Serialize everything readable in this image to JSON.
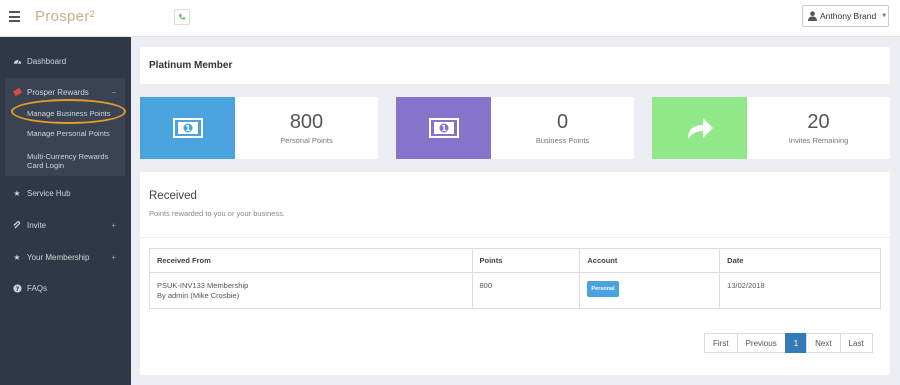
{
  "header": {
    "logo": "Prosper²",
    "user_name": "Anthony Brand"
  },
  "sidebar": {
    "items": [
      {
        "label": "Dashboard",
        "icon": "dashboard-icon"
      },
      {
        "label": "Prosper Rewards",
        "icon": "ticket-icon",
        "toggle": "−"
      },
      {
        "label": "Service Hub",
        "icon": "star-icon"
      },
      {
        "label": "Invite",
        "icon": "paperclip-icon",
        "toggle": "+"
      },
      {
        "label": "Your Membership",
        "icon": "star-icon",
        "toggle": "+"
      },
      {
        "label": "FAQs",
        "icon": "question-icon"
      }
    ],
    "rewards_sub": [
      {
        "label": "Manage Business Points"
      },
      {
        "label": "Manage Personal Points"
      },
      {
        "label": "Multi-Currency Rewards Card Login"
      }
    ]
  },
  "main": {
    "title": "Platinum Member",
    "stats": [
      {
        "value": "800",
        "label": "Personal Points",
        "color": "#4aa3df",
        "icon": "money-icon"
      },
      {
        "value": "0",
        "label": "Business Points",
        "color": "#8574c9",
        "icon": "money-icon"
      },
      {
        "value": "20",
        "label": "Invites Remaining",
        "color": "#90e889",
        "icon": "share-arrow-icon"
      }
    ],
    "received": {
      "heading": "Received",
      "subheading": "Points rewarded to you or your business.",
      "columns": [
        "Received From",
        "Points",
        "Account",
        "Date"
      ],
      "rows": [
        {
          "from_line1": "PSUK-INV133 Membership",
          "from_line2": "By admin (Mike Crosbie)",
          "points": "800",
          "account": "Personal",
          "date": "13/02/2018"
        }
      ]
    },
    "pagination": [
      "First",
      "Previous",
      "1",
      "Next",
      "Last"
    ],
    "pagination_active": "1"
  }
}
